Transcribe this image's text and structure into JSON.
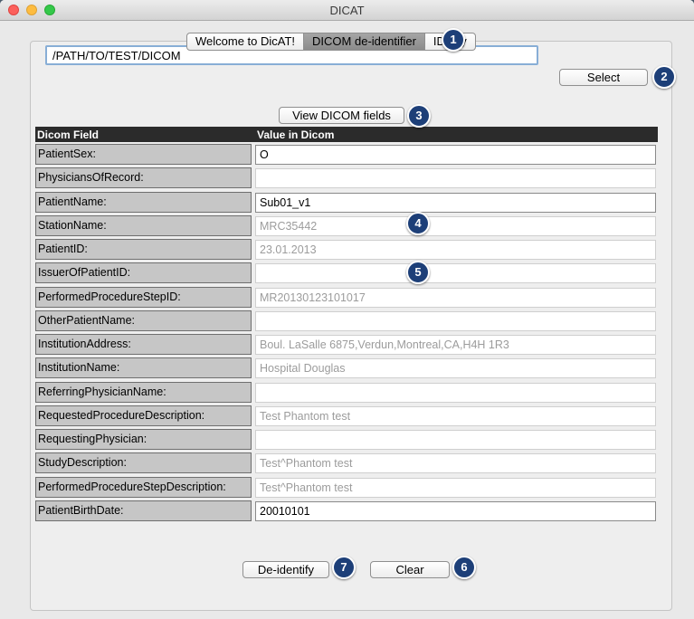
{
  "window": {
    "title": "DICAT"
  },
  "tabs": [
    {
      "label": "Welcome to DicAT!"
    },
    {
      "label": "DICOM de-identifier"
    },
    {
      "label": "ID key"
    }
  ],
  "path": {
    "value": "/PATH/TO/TEST/DICOM"
  },
  "buttons": {
    "select": "Select",
    "view_fields": "View DICOM fields",
    "deidentify": "De-identify",
    "clear": "Clear"
  },
  "badges": [
    "1",
    "2",
    "3",
    "4",
    "5",
    "6",
    "7"
  ],
  "table": {
    "headers": {
      "field": "Dicom Field",
      "value": "Value in Dicom"
    },
    "rows": [
      {
        "field": "PatientSex:",
        "value": "O",
        "editable": true
      },
      {
        "field": "PhysiciansOfRecord:",
        "value": "",
        "editable": false
      },
      {
        "field": "PatientName:",
        "value": "Sub01_v1",
        "editable": true
      },
      {
        "field": "StationName:",
        "value": "MRC35442",
        "editable": false
      },
      {
        "field": "PatientID:",
        "value": "23.01.2013",
        "editable": false
      },
      {
        "field": "IssuerOfPatientID:",
        "value": "",
        "editable": false
      },
      {
        "field": "PerformedProcedureStepID:",
        "value": "MR20130123101017",
        "editable": false
      },
      {
        "field": "OtherPatientName:",
        "value": "",
        "editable": false
      },
      {
        "field": "InstitutionAddress:",
        "value": "Boul. LaSalle 6875,Verdun,Montreal,CA,H4H 1R3",
        "editable": false
      },
      {
        "field": "InstitutionName:",
        "value": "Hospital Douglas",
        "editable": false
      },
      {
        "field": "ReferringPhysicianName:",
        "value": "",
        "editable": false
      },
      {
        "field": "RequestedProcedureDescription:",
        "value": "Test Phantom test",
        "editable": false
      },
      {
        "field": "RequestingPhysician:",
        "value": "",
        "editable": false
      },
      {
        "field": "StudyDescription:",
        "value": "Test^Phantom test",
        "editable": false
      },
      {
        "field": "PerformedProcedureStepDescription:",
        "value": "Test^Phantom test",
        "editable": false
      },
      {
        "field": "PatientBirthDate:",
        "value": "20010101",
        "editable": true
      }
    ]
  }
}
